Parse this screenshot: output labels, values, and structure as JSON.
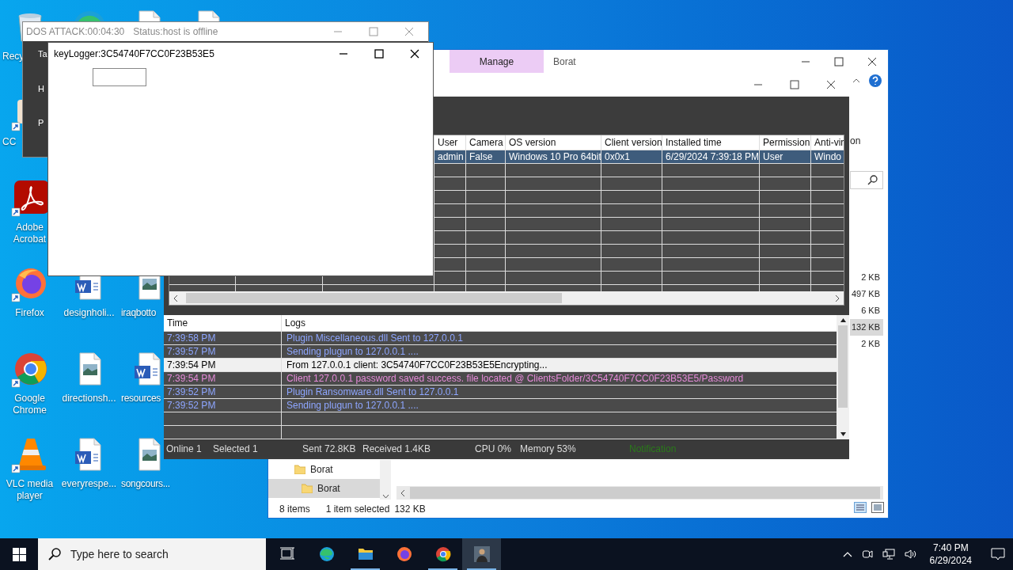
{
  "desktop_icons": [
    [
      {
        "kind": "recycle",
        "label": "Recy"
      },
      {
        "kind": "edge"
      },
      {
        "kind": "word"
      },
      {
        "kind": "word"
      }
    ],
    [
      {
        "kind": "shortcut",
        "label": "CC"
      }
    ],
    [
      {
        "kind": "acrobat",
        "label": "Adobe Acrobat"
      }
    ],
    [
      {
        "kind": "firefox",
        "label": "Firefox"
      },
      {
        "kind": "word",
        "label": "designholi..."
      },
      {
        "kind": "picture",
        "label": "iraqbotto"
      }
    ],
    [
      {
        "kind": "chrome",
        "label": "Google Chrome"
      },
      {
        "kind": "picture",
        "label": "directionsh..."
      },
      {
        "kind": "word",
        "label": "resources"
      }
    ],
    [
      {
        "kind": "vlc",
        "label": "VLC media player"
      },
      {
        "kind": "word",
        "label": "everyrespe..."
      },
      {
        "kind": "picture",
        "label": "songcours..."
      }
    ]
  ],
  "explorer": {
    "tabs": [
      {
        "label": "Manage",
        "selected": true
      },
      {
        "label": "Borat",
        "selected": false
      }
    ],
    "side_text": "on",
    "sizes": [
      {
        "text": "2 KB",
        "selected": false
      },
      {
        "text": "497 KB",
        "selected": false
      },
      {
        "text": "6 KB",
        "selected": false
      },
      {
        "text": "132 KB",
        "selected": true
      },
      {
        "text": "2 KB",
        "selected": false
      }
    ],
    "tree": [
      {
        "label": "Borat",
        "selected": false
      },
      {
        "label": "Borat",
        "selected": true
      }
    ],
    "status": [
      "8 items",
      "1 item selected",
      "132 KB"
    ]
  },
  "client_panel": {
    "columns": [
      "User",
      "Camera",
      "OS version",
      "Client version",
      "Installed time",
      "Permission",
      "Anti-vir"
    ],
    "rows": [
      {
        "selected": true,
        "cells": [
          "admin",
          "False",
          "Windows 10 Pro 64bit",
          "0x0x1",
          "6/29/2024 7:39:18 PM",
          "User",
          "Windo"
        ]
      }
    ],
    "log_columns": [
      "Time",
      "Logs"
    ],
    "logs": [
      {
        "time": "7:39:58 PM",
        "text": "Plugin Miscellaneous.dll Sent to 127.0.0.1",
        "color": "#8ea6ff",
        "selected": false
      },
      {
        "time": "7:39:57 PM",
        "text": "Sending plugun to 127.0.0.1  ....",
        "color": "#8ea6ff",
        "selected": false
      },
      {
        "time": "7:39:54 PM",
        "text": "From 127.0.0.1 client: 3C54740F7CC0F23B53E5Encrypting...",
        "color": "#000000",
        "selected": true
      },
      {
        "time": "7:39:54 PM",
        "text": "Client 127.0.0.1 password saved success. file located @ ClientsFolder/3C54740F7CC0F23B53E5/Password",
        "color": "#e58ad8",
        "selected": false
      },
      {
        "time": "7:39:52 PM",
        "text": "Plugin Ransomware.dll Sent to 127.0.0.1",
        "color": "#8ea6ff",
        "selected": false
      },
      {
        "time": "7:39:52 PM",
        "text": "Sending plugun to 127.0.0.1  ....",
        "color": "#8ea6ff",
        "selected": false
      }
    ],
    "status_bar": [
      "Online 1",
      "Selected 1",
      "Sent 72.8KB",
      "Received  1.4KB",
      "CPU 0%",
      "Memory 53%"
    ],
    "notification": "Notification"
  },
  "dos_window": {
    "title": "DOS ATTACK:00:04:30",
    "status": "Status:host is offline",
    "labels": [
      "Ta",
      "H",
      "P"
    ]
  },
  "keylogger": {
    "title": "keyLogger:3C54740F7CC0F23B53E5"
  },
  "taskbar": {
    "search_placeholder": "Type here to search",
    "apps": [
      {
        "kind": "taskview",
        "running": false,
        "selected": false
      },
      {
        "kind": "edge",
        "running": false,
        "selected": false
      },
      {
        "kind": "explorer",
        "running": true,
        "selected": false
      },
      {
        "kind": "firefox",
        "running": false,
        "selected": false
      },
      {
        "kind": "chrome",
        "running": true,
        "selected": false
      },
      {
        "kind": "figure",
        "running": true,
        "selected": true
      }
    ],
    "time": "7:40 PM",
    "date": "6/29/2024"
  }
}
